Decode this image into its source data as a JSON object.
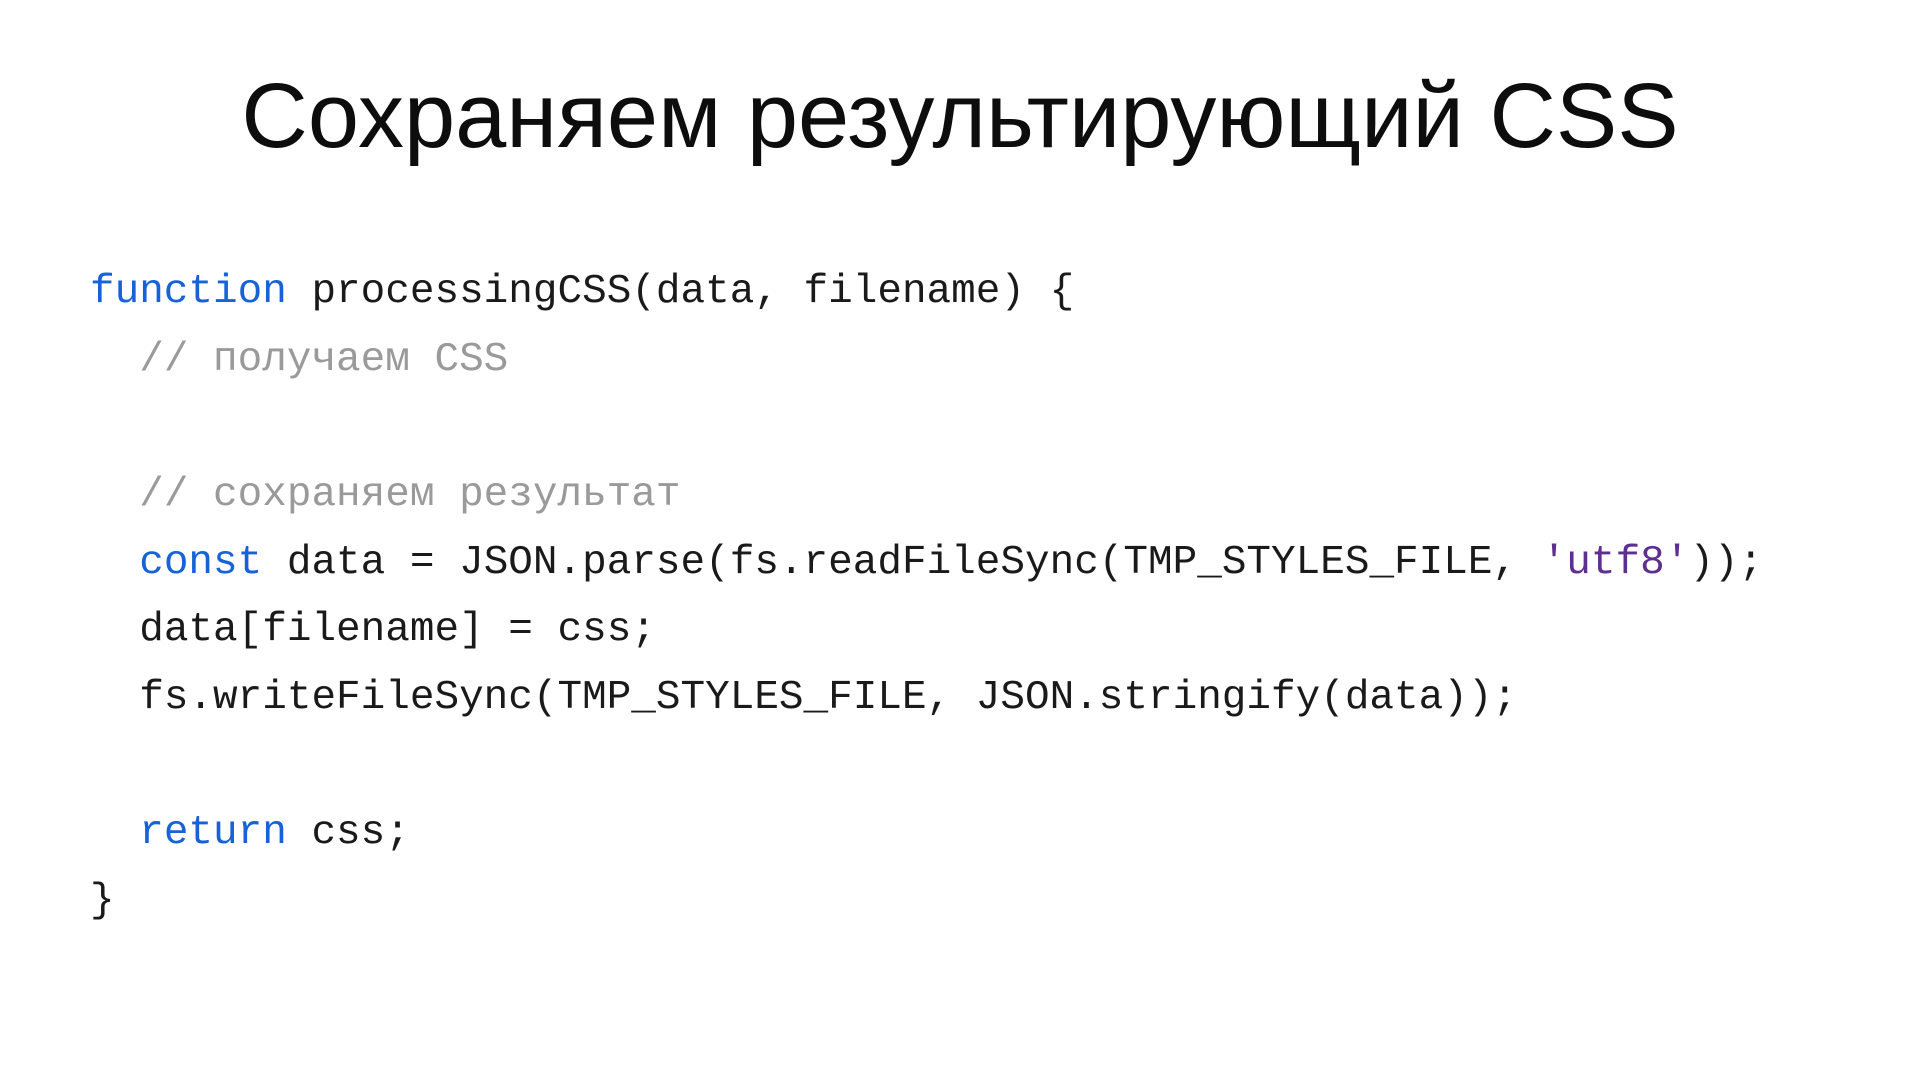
{
  "title": "Сохраняем результирующий CSS",
  "code": {
    "kw_function": "function",
    "fn_name": " processingCSS",
    "params_open": "(data, filename) {",
    "comment_get": "// получаем CSS",
    "comment_save": "// сохраняем результат",
    "kw_const": "const",
    "const_line_1a": " data = ",
    "const_line_1b": "JSON.parse",
    "const_line_1c": "(fs.readFileSync(TMP_STYLES_FILE, ",
    "str_utf8": "'utf8'",
    "const_line_1d": "));",
    "assign_line": "data[filename] = css;",
    "write_line": "fs.writeFileSync(TMP_STYLES_FILE, JSON.stringify(data));",
    "kw_return": "return",
    "return_rest": " css;",
    "close_brace": "}"
  }
}
